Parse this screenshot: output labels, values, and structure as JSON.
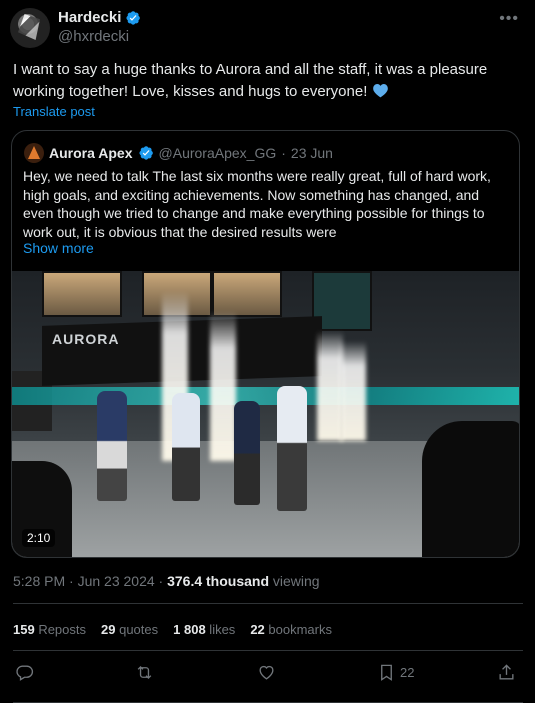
{
  "author": {
    "name": "Hardecki",
    "handle": "@hxrdecki"
  },
  "tweet": {
    "text": "I want to say a huge thanks to Aurora and all the staff, it was a pleasure working together! Love, kisses and hugs to everyone!",
    "translate_label": "Translate post"
  },
  "quote": {
    "name": "Aurora Apex",
    "handle": "@AuroraApex_GG",
    "separator": "·",
    "date": "23 Jun",
    "text": "Hey, we need to talk The last six months were really great, full of hard work, high goals, and exciting achievements. Now something has changed, and even though we tried to change and make everything possible for things to work out, it is obvious that the desired results were",
    "show_more": "Show more",
    "media": {
      "banner_text": "AURORA",
      "duration": "2:10"
    }
  },
  "meta": {
    "time": "5:28 PM · Jun 23 2024 · ",
    "views": "376.4 thousand",
    "views_suffix": " viewing"
  },
  "stats": {
    "reposts_count": "159",
    "reposts_label": " Reposts",
    "quotes_count": "29",
    "quotes_label": " quotes",
    "likes_count": "1 808",
    "likes_label": " likes",
    "bookmarks_count": "22",
    "bookmarks_label": " bookmarks"
  },
  "actions": {
    "bookmark_count": "22"
  },
  "colors": {
    "accent": "#1d9bf0",
    "muted": "#71767b",
    "text": "#e7e9ea",
    "border": "#2f3336",
    "background": "#000000"
  },
  "icons": [
    "more-icon",
    "verified-badge-icon",
    "blue-heart-icon",
    "reply-icon",
    "repost-icon",
    "like-icon",
    "bookmark-icon",
    "share-icon"
  ]
}
